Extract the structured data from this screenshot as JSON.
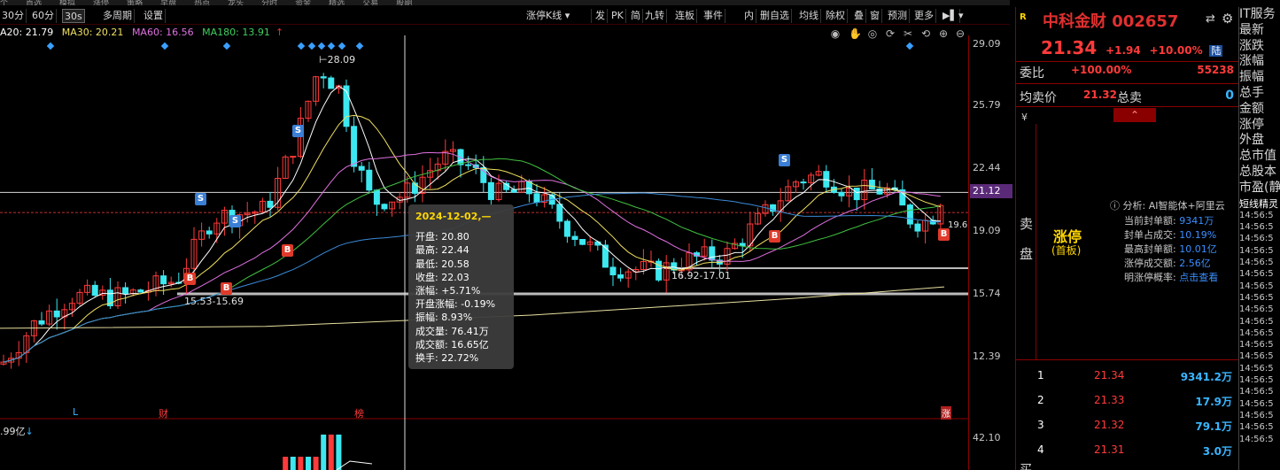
{
  "menu_strip": [
    "个",
    "首选",
    "模拟",
    "涨停",
    "策略",
    "早盘",
    "热点",
    "龙头",
    "分时",
    "资金",
    "精选",
    "交易",
    "股期"
  ],
  "toolbar": {
    "periods": [
      "30分",
      "60分",
      "30s",
      "多周期",
      "设置"
    ],
    "selected_period": "30s",
    "indicator_select": "涨停K线",
    "buttons": [
      "发",
      "PK",
      "简",
      "九转",
      "连板",
      "事件",
      "内",
      "删自选",
      "均线",
      "除权",
      "叠",
      "窗",
      "预测",
      "更多"
    ]
  },
  "ma_line": {
    "ma20": "A20: 21.79",
    "ma30": "MA30: 20.21",
    "ma60": "MA60: 16.56",
    "ma180": "MA180: 13.91"
  },
  "price_axis": {
    "ticks": [
      "29.09",
      "25.79",
      "22.44",
      "19.09",
      "15.74",
      "12.39"
    ],
    "current": "21.12",
    "sub_tick": "42.10"
  },
  "annotations": {
    "high_label": "28.09",
    "range_left": "15.53-15.69",
    "range_mid": "16.92-17.01",
    "right_edge": "19.6"
  },
  "signals": {
    "sell": [
      "S",
      "S",
      "S",
      "S"
    ],
    "buy": [
      "B",
      "B",
      "B",
      "B",
      "B",
      "B"
    ]
  },
  "event_labels": [
    "L",
    "财",
    "榜",
    "涨"
  ],
  "volume_label": ".99亿",
  "tooltip": {
    "date": "2024-12-02,—",
    "open": "开盘: 20.80",
    "high": "最高: 22.44",
    "low": "最低: 20.58",
    "close": "收盘: 22.03",
    "change": "涨幅: +5.71%",
    "open_change": "开盘涨幅: -0.19%",
    "amplitude": "振幅: 8.93%",
    "volume": "成交量: 76.41万",
    "amount": "成交额: 16.65亿",
    "turnover": "换手: 22.72%"
  },
  "quote": {
    "badge": "R",
    "name": "中科金财 002657",
    "price": "21.34",
    "change": "+1.94",
    "change_pct": "+10.00%",
    "exchange": "陆",
    "weibi_label": "委比",
    "weibi_value": "+100.00%",
    "weicha_value": "55238",
    "avg_label": "均卖价",
    "avg_value": "21.32",
    "total_sell_label": "总卖",
    "total_sell_value": "0",
    "sell_side_label": "卖盘",
    "status": "涨停",
    "status_sub": "(首板)",
    "info_title": "分析: AI智能体+阿里云",
    "info": [
      {
        "k": "当前封单额:",
        "v": "9341万"
      },
      {
        "k": "封单占成交:",
        "v": "10.19%"
      },
      {
        "k": "最高封单额:",
        "v": "10.01亿"
      },
      {
        "k": "涨停成交额:",
        "v": "2.56亿"
      },
      {
        "k": "明涨停概率:",
        "v": "点击查看"
      }
    ],
    "order_book": [
      {
        "n": "1",
        "p": "21.34",
        "q": "9341.2万"
      },
      {
        "n": "2",
        "p": "21.33",
        "q": "17.9万"
      },
      {
        "n": "3",
        "p": "21.32",
        "q": "79.1万"
      },
      {
        "n": "4",
        "p": "21.31",
        "q": "3.0万"
      }
    ],
    "bottom_label": "买"
  },
  "side_list": {
    "labels": [
      "IT服务",
      "最新",
      "涨跌",
      "涨幅",
      "振幅",
      "总手",
      "金额",
      "涨停",
      "外盘",
      "总市值",
      "总股本",
      "市盈(静)"
    ],
    "header": "短线精灵",
    "times": [
      "14:56:5",
      "14:56:5",
      "14:56:5",
      "14:56:5",
      "14:56:5",
      "14:56:5",
      "14:56:5",
      "14:56:5",
      "14:56:5",
      "14:56:5",
      "14:56:5",
      "14:56:5",
      "14:56:5",
      "14:56:5",
      "14:56:5",
      "14:56:5",
      "14:56:5",
      "14:56:5",
      "14:56:5",
      "14:56:5"
    ]
  },
  "colors": {
    "up": "#ff3a3a",
    "down": "#3de8f0",
    "ma_white": "#ffffff",
    "ma_yellow": "#f0e060",
    "ma_pink": "#e070e0",
    "ma_green": "#40c040",
    "ma_blue": "#3a8ad8"
  }
}
